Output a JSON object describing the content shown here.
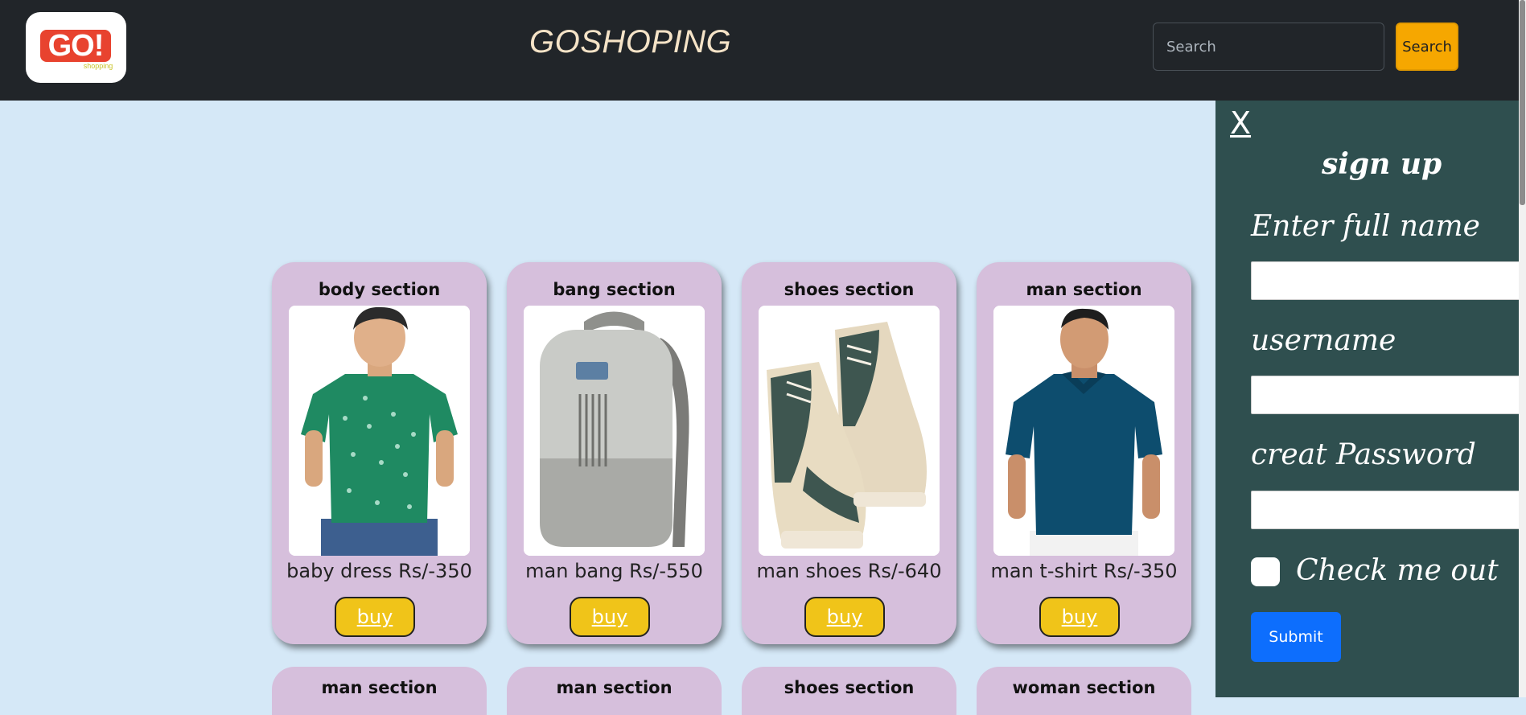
{
  "header": {
    "logo_text": "GO!",
    "logo_sub": "shopping",
    "brand": "GOSHOPING",
    "search_placeholder": "Search",
    "search_button": "Search"
  },
  "products": [
    {
      "section": "body section",
      "caption": "baby dress Rs/-350",
      "buy": "buy"
    },
    {
      "section": "bang section",
      "caption": "man bang Rs/-550",
      "buy": "buy"
    },
    {
      "section": "shoes section",
      "caption": "man shoes Rs/-640",
      "buy": "buy"
    },
    {
      "section": "man section",
      "caption": "man t-shirt Rs/-350",
      "buy": "buy"
    }
  ],
  "next_row": [
    {
      "section": "man section"
    },
    {
      "section": "man section"
    },
    {
      "section": "shoes section"
    },
    {
      "section": "woman section"
    }
  ],
  "signup": {
    "close": "X",
    "title": "sign up",
    "full_name_label": "Enter full name",
    "username_label": "username",
    "password_label": "creat Password",
    "check_label": "Check me out",
    "submit": "Submit"
  },
  "colors": {
    "header_bg": "#212529",
    "page_bg": "#d5e8f7",
    "card_bg": "#d6bfdc",
    "buy_bg": "#f0c419",
    "search_btn": "#f6a700",
    "panel_bg": "#2f4f4f",
    "submit_bg": "#0d6efd"
  }
}
